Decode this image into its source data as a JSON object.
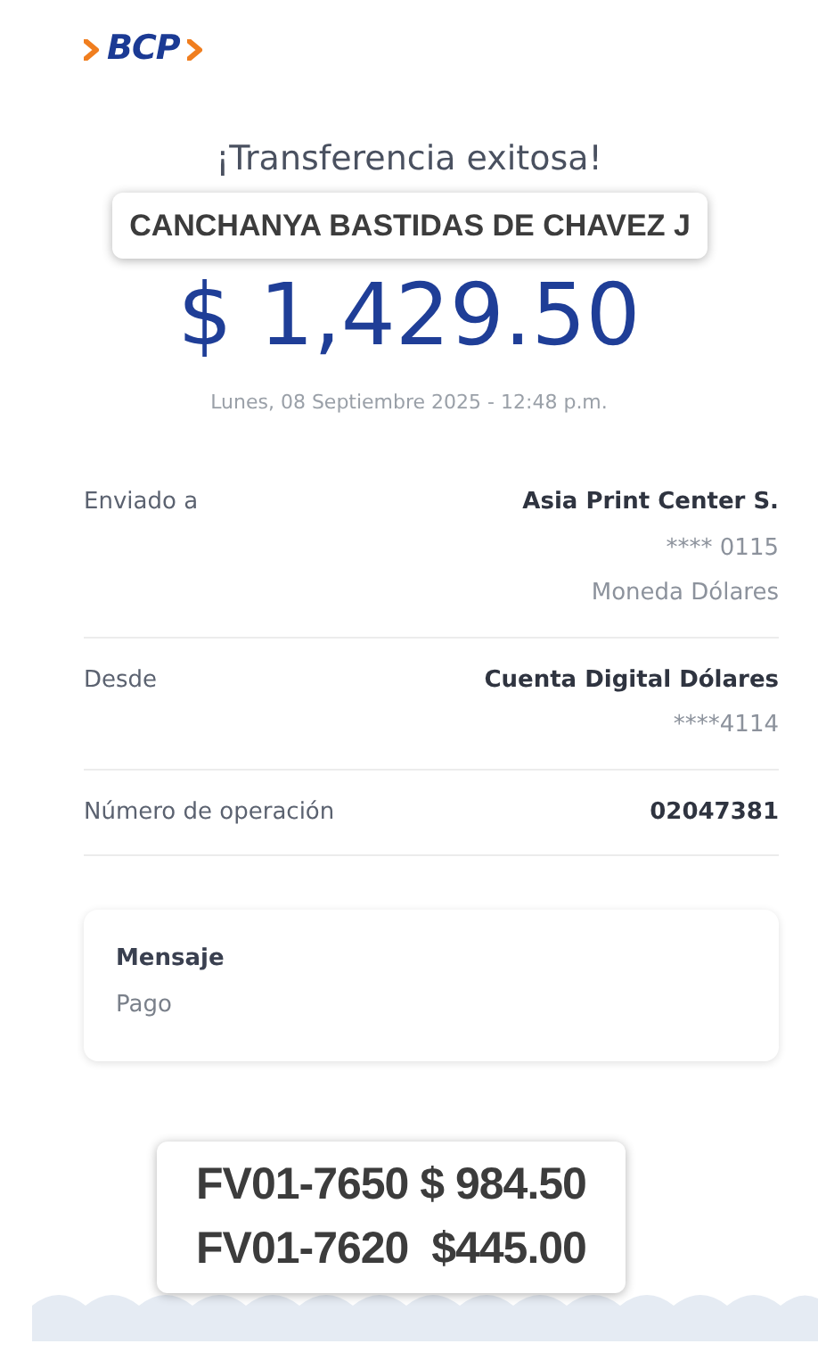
{
  "logo": {
    "text": "BCP"
  },
  "title": "¡Transferencia exitosa!",
  "name_label": "CANCHANYA BASTIDAS DE CHAVEZ J",
  "amount": "$ 1,429.50",
  "date": "Lunes, 08 Septiembre 2025 - 12:48 p.m.",
  "details": [
    {
      "label": "Enviado a",
      "value": "Asia Print Center S.",
      "sub": [
        "**** 0115",
        "Moneda Dólares"
      ]
    },
    {
      "label": "Desde",
      "value": "Cuenta Digital Dólares",
      "sub": [
        "****4114"
      ]
    },
    {
      "label": "Número de operación",
      "value": "02047381"
    }
  ],
  "message": {
    "label": "Mensaje",
    "text": "Pago"
  },
  "invoice_note": [
    "FV01-7650 $ 984.50",
    "FV01-7620  $445.00"
  ]
}
